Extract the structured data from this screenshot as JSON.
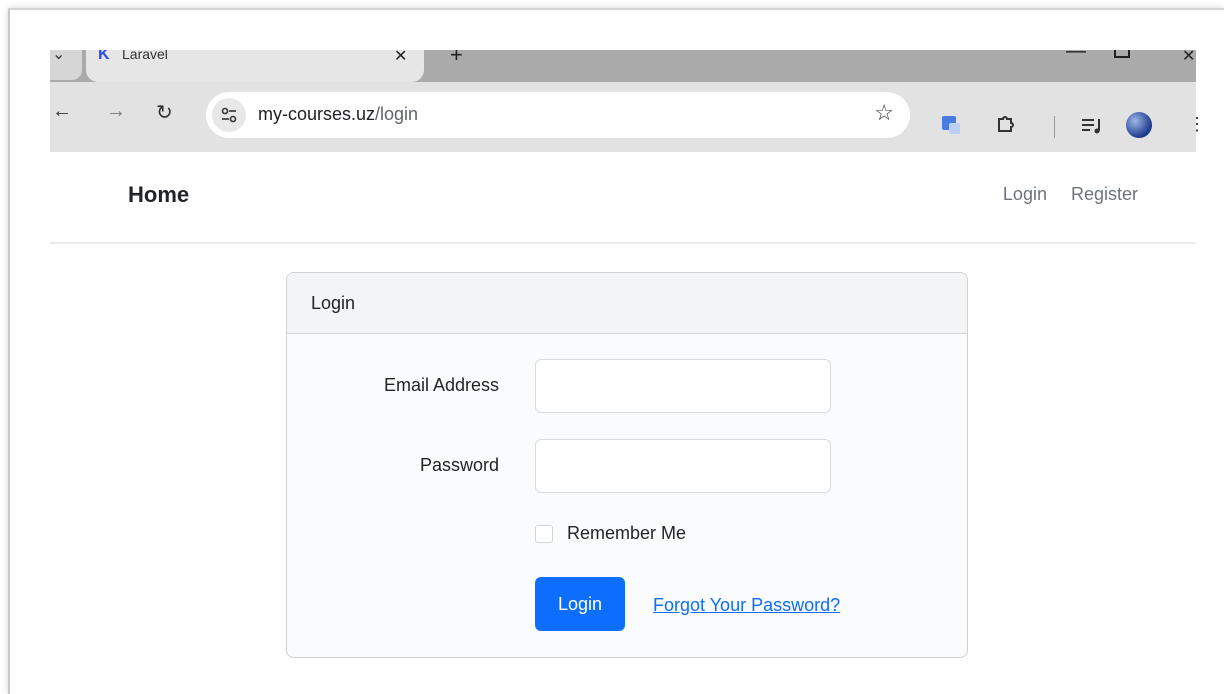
{
  "browser": {
    "tab_title": "Laravel",
    "tab_favicon": "K",
    "url_host": "my-courses.uz",
    "url_path": "/login"
  },
  "navbar": {
    "brand": "Home",
    "links": [
      "Login",
      "Register"
    ]
  },
  "card": {
    "header": "Login",
    "email_label": "Email Address",
    "password_label": "Password",
    "remember_label": "Remember Me",
    "submit_label": "Login",
    "forgot_label": "Forgot Your Password?"
  },
  "colors": {
    "primary": "#0d6efd",
    "toolbar": "#e2e2e2",
    "tabstrip": "#aaaaaa"
  }
}
